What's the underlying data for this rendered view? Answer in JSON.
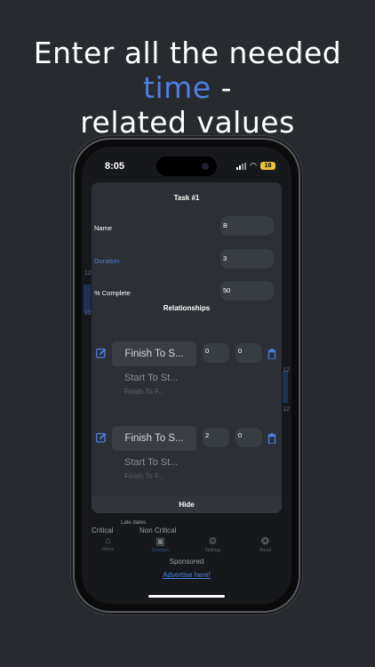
{
  "headline": {
    "line1_before": "Enter all the needed ",
    "line1_accent": "time",
    "line1_after": " -",
    "line2": "related values"
  },
  "status_bar": {
    "time": "8:05",
    "battery": "18"
  },
  "modal": {
    "title": "Task #1",
    "fields": [
      {
        "label": "Name",
        "value": "B"
      },
      {
        "label": "Duration",
        "value": "3"
      },
      {
        "label": "% Complete",
        "value": "50"
      }
    ],
    "relationships_title": "Relationships",
    "relationships": [
      {
        "type": "Finish To S...",
        "options": [
          "Start To St...",
          "Finish To F..."
        ],
        "lag1": "0",
        "lag2": "0"
      },
      {
        "type": "Finish To S...",
        "options": [
          "Start To St...",
          "Finish To F..."
        ],
        "lag1": "2",
        "lag2": "0"
      }
    ],
    "hide_label": "Hide"
  },
  "background": {
    "late_dates": "Late dates",
    "legend": [
      "Critical",
      "Non Critical"
    ],
    "side_labels": [
      "12",
      "12",
      "12",
      "12"
    ],
    "tabs": [
      {
        "label": "Home",
        "icon": "home-icon"
      },
      {
        "label": "Structure",
        "icon": "briefcase-icon"
      },
      {
        "label": "Settings",
        "icon": "gear-icon"
      },
      {
        "label": "About",
        "icon": "lifebuoy-icon"
      }
    ],
    "sponsored": "Sponsored",
    "advertise": "Advertise here!"
  },
  "colors": {
    "accent": "#4f7fe0",
    "background": "#272b30",
    "modal": "#2c2f35"
  }
}
